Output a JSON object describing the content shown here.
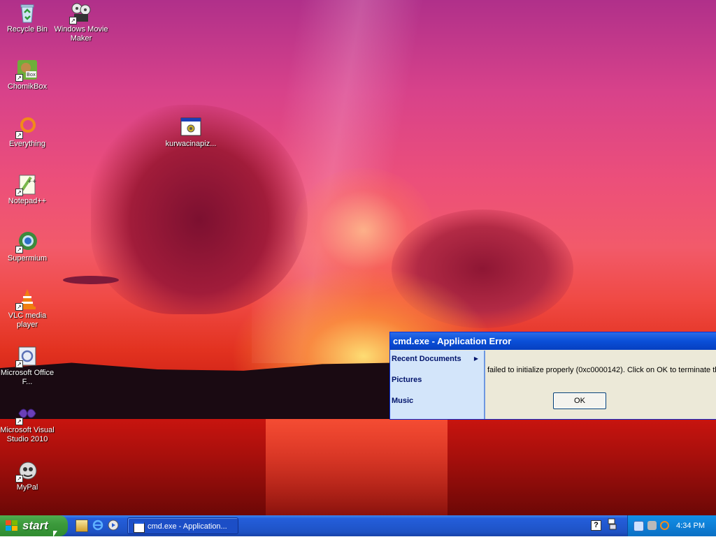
{
  "desktop": {
    "icons": [
      {
        "label": "Recycle Bin",
        "icon": "recycle-bin-icon"
      },
      {
        "label": "Windows Movie Maker",
        "icon": "movie-maker-icon"
      },
      {
        "label": "ChomikBox",
        "icon": "chomikbox-icon"
      },
      {
        "label": "Everything",
        "icon": "everything-search-icon"
      },
      {
        "label": "kurwacinapiz...",
        "icon": "executable-icon"
      },
      {
        "label": "Notepad++",
        "icon": "notepad-plus-plus-icon"
      },
      {
        "label": "Supermium",
        "icon": "supermium-browser-icon"
      },
      {
        "label": "VLC media player",
        "icon": "vlc-icon"
      },
      {
        "label": "Microsoft Office F...",
        "icon": "office-icon"
      },
      {
        "label": "Microsoft Visual Studio 2010",
        "icon": "visual-studio-icon"
      },
      {
        "label": "MyPal",
        "icon": "mypal-browser-icon"
      }
    ]
  },
  "dialog": {
    "title": "cmd.exe - Application Error",
    "message": "failed to initialize properly (0xc0000142). Click on OK to terminate th",
    "ok_label": "OK"
  },
  "start_menu_fragment": {
    "items": [
      {
        "label": "Recent Documents",
        "has_submenu": true
      },
      {
        "label": "Pictures",
        "has_submenu": false
      },
      {
        "label": "Music",
        "has_submenu": false
      }
    ]
  },
  "taskbar": {
    "start_label": "start",
    "quick_launch": [
      "show-desktop-icon",
      "internet-explorer-icon",
      "windows-media-player-icon"
    ],
    "task_buttons": [
      {
        "label": "cmd.exe - Application..."
      }
    ],
    "clock": "4:34 PM"
  },
  "colors": {
    "taskbar_blue": "#245edb",
    "start_green": "#3c9a3c",
    "titlebar_blue": "#0a4fd8",
    "dialog_bg": "#ece9d8",
    "tray_blue": "#0e7fd6"
  }
}
